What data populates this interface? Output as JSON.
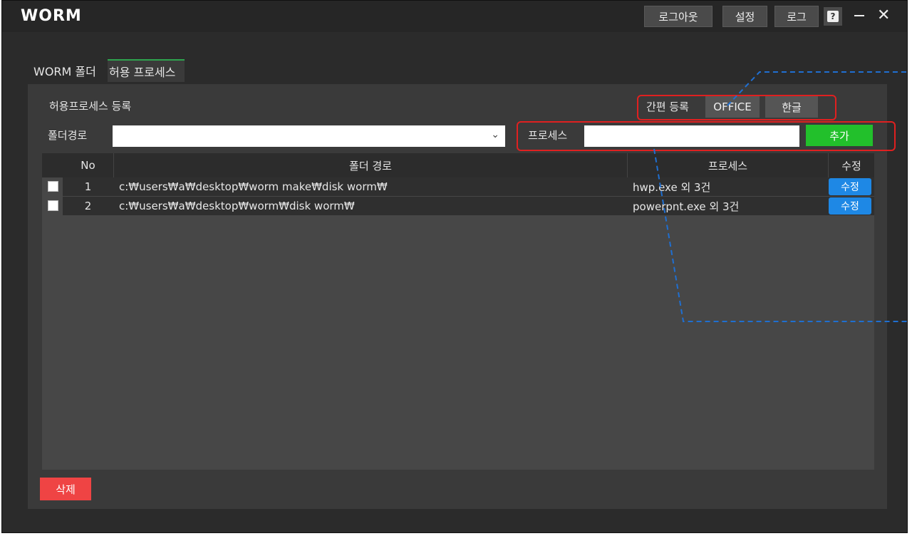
{
  "app": {
    "logo": "WORM"
  },
  "titlebar": {
    "logout_label": "로그아웃",
    "settings_label": "설정",
    "log_label": "로그",
    "help_glyph": "?",
    "minimize_glyph": "—",
    "close_glyph": "✕"
  },
  "tabs": [
    {
      "label": "WORM 폴더",
      "active": false
    },
    {
      "label": "허용 프로세스",
      "active": true
    }
  ],
  "form": {
    "section_title": "허용프로세스 등록",
    "quick_register_label": "간편 등록",
    "office_label": "OFFICE",
    "hangul_label": "한글",
    "folder_path_label": "폴더경로",
    "folder_path_value": "",
    "process_label": "프로세스",
    "process_value": "",
    "add_label": "추가"
  },
  "table": {
    "headers": {
      "no": "No",
      "folder_path": "폴더 경로",
      "process": "프로세스",
      "edit": "수정"
    },
    "rows": [
      {
        "no": "1",
        "folder_path": "c:₩users₩a₩desktop₩worm make₩disk worm₩",
        "process": "hwp.exe 외 3건",
        "edit_label": "수정",
        "checked": false
      },
      {
        "no": "2",
        "folder_path": "c:₩users₩a₩desktop₩worm₩disk worm₩",
        "process": "powerpnt.exe 외 3건",
        "edit_label": "수정",
        "checked": false
      }
    ]
  },
  "footer": {
    "delete_label": "삭제"
  },
  "colors": {
    "background": "#2b2b2b",
    "panel": "#3a3a3a",
    "add_button": "#22c02b",
    "edit_button": "#1e88e5",
    "delete_button": "#ef4444",
    "highlight_box": "#e02020",
    "annotation_line": "#1f6fd1"
  }
}
